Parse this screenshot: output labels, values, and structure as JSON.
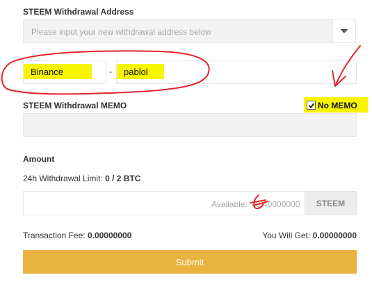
{
  "address_section": {
    "title": "STEEM Withdrawal Address",
    "address_placeholder": "Please input your new withdrawal address below",
    "exchange_value": "Binance",
    "separator": "-",
    "account_value": "pablol"
  },
  "memo_section": {
    "title": "STEEM Withdrawal MEMO",
    "no_memo_label": "No MEMO",
    "no_memo_checked": true
  },
  "amount_section": {
    "title": "Amount",
    "limit_prefix": "24h Withdrawal Limit:",
    "limit_value": "0 / 2 BTC",
    "available_label": "Available:",
    "available_value": "0.40000000",
    "unit": "STEEM"
  },
  "summary": {
    "fee_label": "Transaction Fee:",
    "fee_value": "0.00000000",
    "get_label": "You Will Get:",
    "get_value": "0.00000000"
  },
  "submit_label": "Submit",
  "colors": {
    "highlight": "#f7f600",
    "annotation": "#e5232a",
    "submit": "#e8b43f"
  }
}
